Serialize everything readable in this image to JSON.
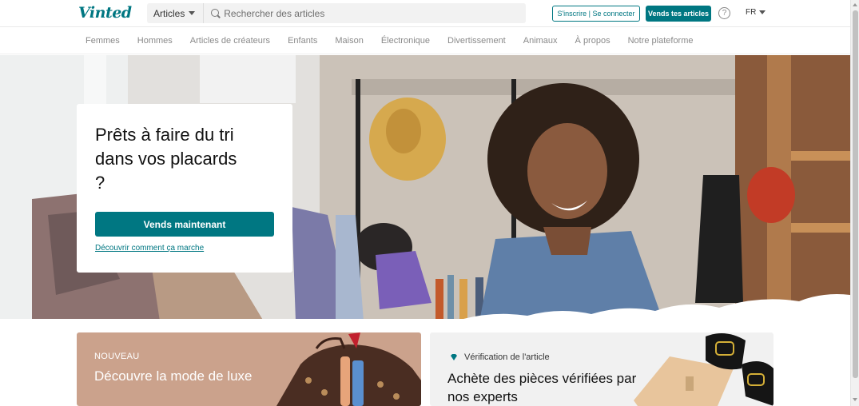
{
  "header": {
    "logo": "Vinted",
    "search_category": "Articles",
    "search_placeholder": "Rechercher des articles",
    "login_label": "S'inscrire | Se connecter",
    "sell_label": "Vends tes articles",
    "help_icon": "?",
    "language": "FR"
  },
  "nav": {
    "items": [
      "Femmes",
      "Hommes",
      "Articles de créateurs",
      "Enfants",
      "Maison",
      "Électronique",
      "Divertissement",
      "Animaux",
      "À propos",
      "Notre plateforme"
    ]
  },
  "hero": {
    "title": "Prêts à faire du tri dans vos placards ?",
    "cta_label": "Vends maintenant",
    "link_label": "Découvrir comment ça marche"
  },
  "promos": {
    "luxe": {
      "eyebrow": "NOUVEAU",
      "title": "Découvre la mode de luxe"
    },
    "verification": {
      "eyebrow": "Vérification de l'article",
      "title": "Achète des pièces vérifiées par nos experts"
    }
  },
  "colors": {
    "accent": "#007782",
    "luxe_bg": "#cba28c",
    "verif_bg": "#f1f1f1"
  },
  "icons": {
    "search": "search-icon",
    "help": "help-icon",
    "caret": "chevron-down-icon",
    "diamond": "diamond-icon"
  }
}
